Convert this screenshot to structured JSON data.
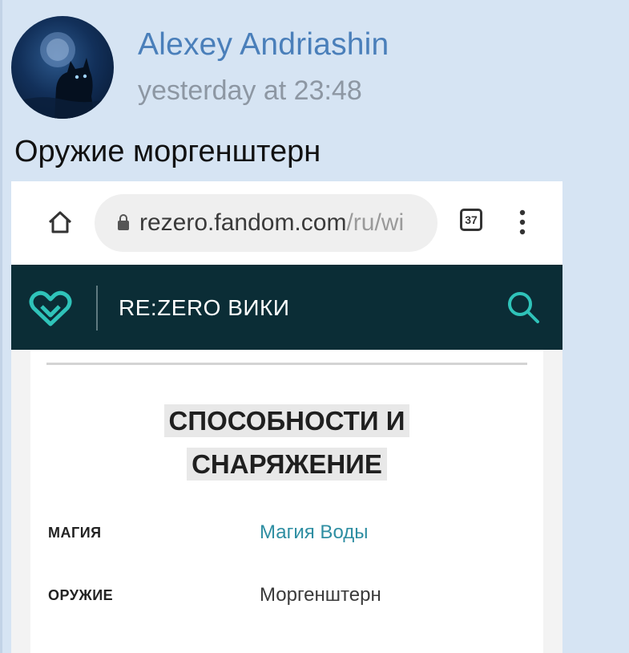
{
  "post": {
    "author": "Alexey Andriashin",
    "timestamp": "yesterday at 23:48",
    "message": "Оружие моргенштерн"
  },
  "browser": {
    "url_host": "rezero.fandom.com",
    "url_path": "/ru/wi",
    "tab_count": "37"
  },
  "wiki": {
    "title": "RE:ZERO ВИКИ"
  },
  "section": {
    "heading_line1": "СПОСОБНОСТИ И",
    "heading_line2": "СНАРЯЖЕНИЕ",
    "rows": [
      {
        "label": "МАГИЯ",
        "value": "Магия Воды"
      },
      {
        "label": "ОРУЖИЕ",
        "value": "Моргенштерн"
      }
    ]
  },
  "colors": {
    "background": "#d6e4f3",
    "author_link": "#4a7fba",
    "wiki_header": "#0b2d36",
    "wiki_accent": "#2fc3b9",
    "link_value": "#2e8ea2"
  },
  "icons": [
    "avatar-image",
    "home-icon",
    "lock-icon",
    "tab-switcher-icon",
    "more-menu-icon",
    "fandom-heart-logo",
    "search-icon"
  ]
}
